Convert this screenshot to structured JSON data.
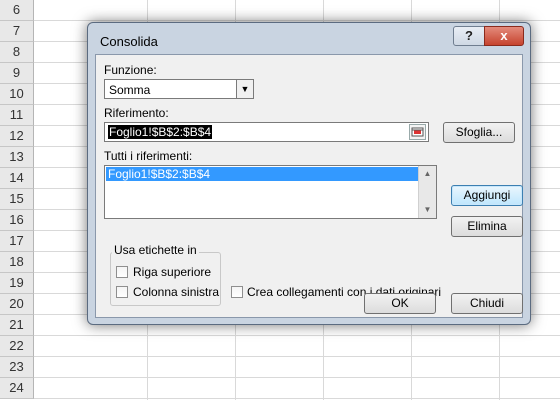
{
  "spreadsheet": {
    "row_numbers": [
      "6",
      "7",
      "8",
      "9",
      "10",
      "11",
      "12",
      "13",
      "14",
      "15",
      "16",
      "17",
      "18",
      "19",
      "20",
      "21",
      "22",
      "23",
      "24"
    ]
  },
  "dialog": {
    "title": "Consolida",
    "help_icon": "?",
    "close_icon": "x",
    "function_label": "Funzione:",
    "function_value": "Somma",
    "reference_label": "Riferimento:",
    "reference_value": "Foglio1!$B$2:$B$4",
    "browse_button": "Sfoglia...",
    "all_references_label": "Tutti i riferimenti:",
    "all_references": [
      "Foglio1!$B$2:$B$4"
    ],
    "add_button": "Aggiungi",
    "delete_button": "Elimina",
    "use_labels_title": "Usa etichette in",
    "top_row_label": "Riga superiore",
    "left_column_label": "Colonna sinistra",
    "create_links_label": "Crea collegamenti con i dati originari",
    "ok_button": "OK",
    "close_button": "Chiudi",
    "top_row_checked": false,
    "left_column_checked": false,
    "create_links_checked": false
  },
  "colors": {
    "dialog_frame": "#c9d4e1",
    "selection": "#3399ff",
    "close_button": "#c6432e"
  }
}
